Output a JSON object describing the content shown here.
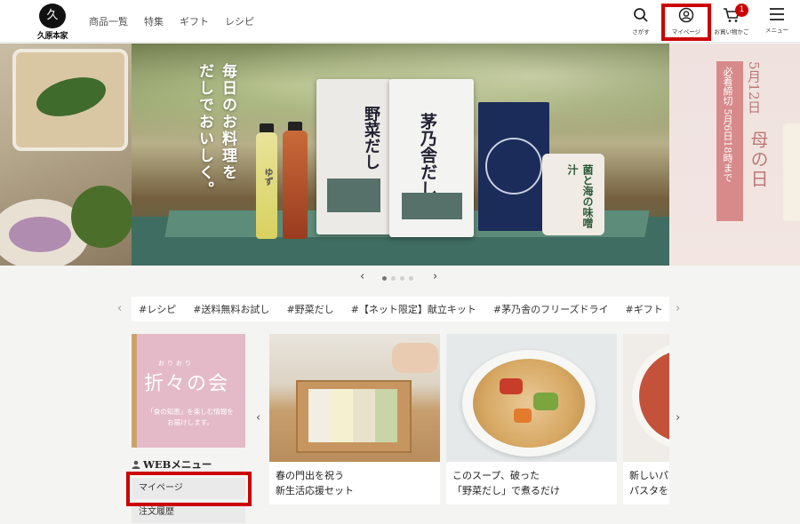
{
  "header": {
    "logo_mark": "久",
    "logo_text": "久原本家",
    "nav": [
      "商品一覧",
      "特集",
      "ギフト",
      "レシピ"
    ],
    "icons": {
      "search": {
        "label": "さがす",
        "icon": "search-icon"
      },
      "mypage": {
        "label": "マイページ",
        "icon": "user-circle-icon"
      },
      "cart": {
        "label": "お買い物かご",
        "icon": "cart-icon",
        "badge": "1"
      },
      "menu": {
        "label": "メニュー",
        "icon": "hamburger-icon"
      }
    }
  },
  "hero": {
    "copy_line1": "毎日のお料理を",
    "copy_line2": "だしでおいしく。",
    "products": {
      "pack1": "野菜だし",
      "pack2": "茅乃舎だし",
      "bag": "菌と海の味噌汁",
      "bottle1": "ゆず"
    },
    "side_banner": {
      "date": "5月12日",
      "deadline": "必着締切 5月6日18時まで",
      "title": "母の日"
    },
    "slides_total": 4,
    "slide_active": 1
  },
  "tags": [
    "#レシピ",
    "#送料無料お試し",
    "#野菜だし",
    "#【ネット限定】献立キット",
    "#茅乃舎のフリーズドライ",
    "#ギフト"
  ],
  "club": {
    "ruby": "おりおり",
    "title": "折々の会",
    "subtitle": "「食の知恵」を楽しむ情報をお届けします。"
  },
  "webmenu": {
    "title": "WEBメニュー",
    "items": [
      "マイページ",
      "注文履歴"
    ]
  },
  "features": [
    {
      "line1": "春の門出を祝う",
      "line2": "新生活応援セット"
    },
    {
      "line1": "このスープ、破った",
      "line2": "「野菜だし」で煮るだけ"
    },
    {
      "line1": "新しいパ",
      "line2": "パスタを"
    }
  ],
  "colors": {
    "highlight": "#cc0000",
    "badge": "#cc0000",
    "club_pink": "#e4bac8"
  }
}
